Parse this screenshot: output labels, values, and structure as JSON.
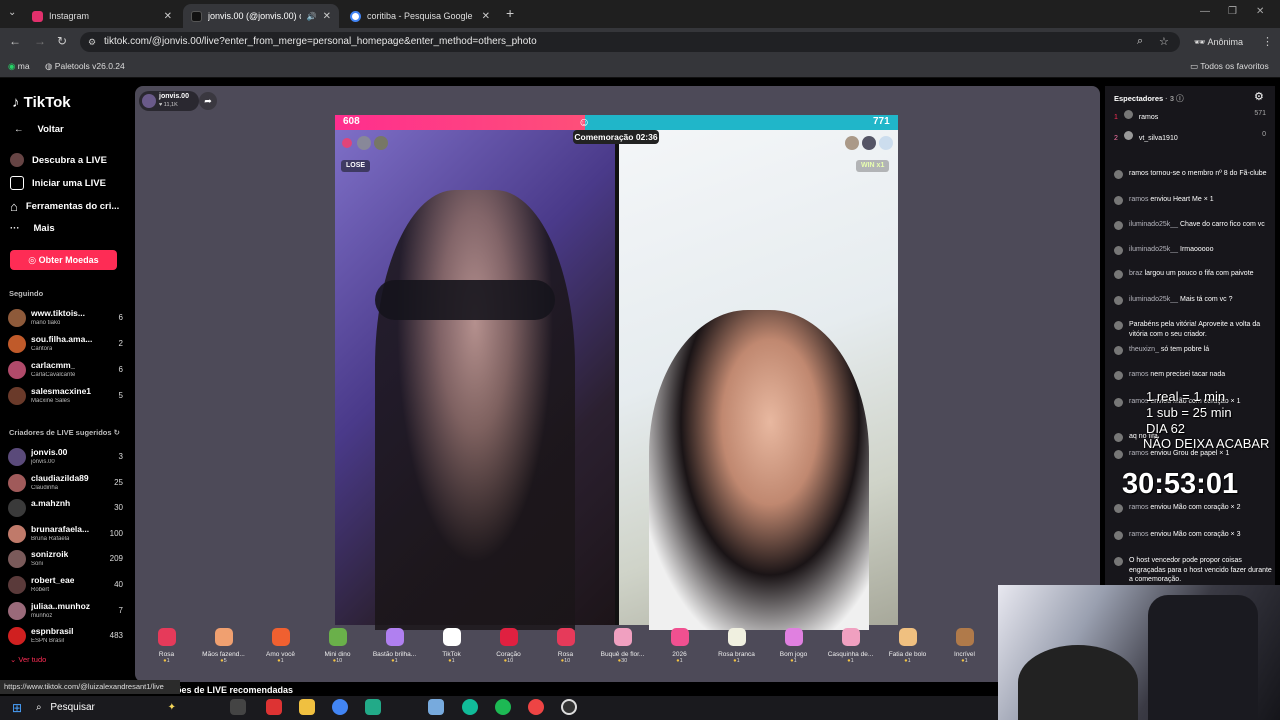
{
  "browser": {
    "tabs": [
      {
        "title": "Instagram",
        "color": "#e1306c"
      },
      {
        "title": "jonvis.00 (@jonvis.00) come",
        "color": "#111111"
      },
      {
        "title": "coritiba - Pesquisa Google",
        "color": "#4285f4"
      }
    ],
    "new_tab": "+",
    "url": "tiktok.com/@jonvis.00/live?enter_from_merge=personal_homepage&enter_method=others_photo",
    "profile": "Anônima",
    "bookmarks": [
      "ma",
      "Paletools v26.0.24"
    ],
    "favorites": "Todos os favoritos"
  },
  "sidebar": {
    "logo": "TikTok",
    "back": "Voltar",
    "nav": [
      "Descubra a LIVE",
      "Iniciar uma LIVE",
      "Ferramentas do cri...",
      "Mais"
    ],
    "coins_button": "Obter Moedas",
    "following_label": "Seguindo",
    "following": [
      {
        "name": "www.tiktois...",
        "sub": "mano tiako",
        "count": "6",
        "color": "#8e5a3a"
      },
      {
        "name": "sou.filha.ama...",
        "sub": "Cantora",
        "count": "2",
        "color": "#c05a2a"
      },
      {
        "name": "carlacmm_",
        "sub": "CarlaCavalcante",
        "count": "6",
        "color": "#b04a6a"
      },
      {
        "name": "salesmacxine1",
        "sub": "Macxine Sales",
        "count": "5",
        "color": "#6a3a2a"
      }
    ],
    "suggested_label": "Criadores de LIVE sugeridos",
    "suggested": [
      {
        "name": "jonvis.00",
        "sub": "jonvis.00",
        "count": "3",
        "color": "#5a4a7a"
      },
      {
        "name": "claudiazilda89",
        "sub": "Claudinha",
        "count": "25",
        "color": "#a05a5a"
      },
      {
        "name": "a.mahznh",
        "sub": "",
        "count": "30",
        "color": "#3a3a3a"
      },
      {
        "name": "brunarafaela...",
        "sub": "Bruna Rafaela",
        "count": "100",
        "color": "#c07a6a"
      },
      {
        "name": "sonizroik",
        "sub": "Soni",
        "count": "209",
        "color": "#7a5a5a"
      },
      {
        "name": "robert_eae",
        "sub": "Robert",
        "count": "40",
        "color": "#5a3a3a"
      },
      {
        "name": "juliaa..munhoz",
        "sub": "munhoz",
        "count": "7",
        "color": "#9a6a7a"
      },
      {
        "name": "espnbrasil",
        "sub": "ESPN Brasil",
        "count": "483",
        "color": "#d02020"
      }
    ],
    "see_all": "Ver tudo"
  },
  "live": {
    "host": "jonvis.00",
    "viewers_short": "11,1K",
    "score_left": "608",
    "score_right": "771",
    "timer": "Comemoração 02:36",
    "lose": "LOSE",
    "win": "WIN x1"
  },
  "gifts": [
    {
      "name": "Rosa",
      "price": "1",
      "color": "#e63a5a"
    },
    {
      "name": "Mãos fazend...",
      "price": "5",
      "color": "#f0a070"
    },
    {
      "name": "Amo você",
      "price": "1",
      "color": "#f06030"
    },
    {
      "name": "Mini dino",
      "price": "10",
      "color": "#6ab04a"
    },
    {
      "name": "Bastão brilha...",
      "price": "1",
      "color": "#b080f0"
    },
    {
      "name": "TikTok",
      "price": "1",
      "color": "#ffffff"
    },
    {
      "name": "Coração",
      "price": "10",
      "color": "#e02040"
    },
    {
      "name": "Rosa",
      "price": "10",
      "color": "#e63a5a"
    },
    {
      "name": "Buquê de flor...",
      "price": "30",
      "color": "#f0a0c0"
    },
    {
      "name": "2026",
      "price": "1",
      "color": "#f05090"
    },
    {
      "name": "Rosa branca",
      "price": "1",
      "color": "#f0f0e0"
    },
    {
      "name": "Bom jogo",
      "price": "1",
      "color": "#e080e0"
    },
    {
      "name": "Casquinha de...",
      "price": "1",
      "color": "#f0a0c0"
    },
    {
      "name": "Fatia de bolo",
      "price": "1",
      "color": "#f0c080"
    },
    {
      "name": "Incrível",
      "price": "1",
      "color": "#b07a4a"
    }
  ],
  "recommended_label": "ões de LIVE recomendadas",
  "chat": {
    "viewers_title": "Espectadores",
    "viewers_count": "· 3",
    "top_viewers": [
      {
        "rank": "1",
        "name": "ramos",
        "score": "571"
      },
      {
        "rank": "2",
        "name": "vt_silva1910",
        "score": "0"
      }
    ],
    "messages": [
      {
        "user": "",
        "text": "ramos tornou-se o membro nº 8 do Fã-clube"
      },
      {
        "user": "ramos",
        "text": "enviou Heart Me × 1"
      },
      {
        "user": "iluminado25k__",
        "text": "Chave do carro fico com vc"
      },
      {
        "user": "iluminado25k__",
        "text": "Irmaooooo"
      },
      {
        "user": "braz",
        "text": "largou um pouco o fifa com paivote"
      },
      {
        "user": "iluminado25k__",
        "text": "Mais tá com vc ?"
      },
      {
        "user": "",
        "text": "Parabéns pela vitória! Aproveite a volta da vitória com o seu criador."
      },
      {
        "user": "theuxizn_",
        "text": "só tem pobre lá"
      },
      {
        "user": "ramos",
        "text": "nem precisei tacar nada"
      },
      {
        "user": "ramos",
        "text": "enviou Mão com coração × 1"
      },
      {
        "user": "",
        "text": "aq no fifa"
      },
      {
        "user": "ramos",
        "text": "enviou Grou de papel × 1"
      },
      {
        "user": "ramos",
        "text": "enviou Mão com coração × 2"
      },
      {
        "user": "ramos",
        "text": "enviou Mão com coração × 3"
      },
      {
        "user": "",
        "text": "O host vencedor pode propor coisas engraçadas para o host vencido fazer durante a comemoração."
      }
    ]
  },
  "overlay": {
    "line1": "1 real = 1 min",
    "line2": "1 sub = 25 min",
    "line3": "DIA 62",
    "line4": "NÃO DEIXA ACABAR",
    "timer": "30:53:01"
  },
  "status_url": "https://www.tiktok.com/@luizalexandresant1/live",
  "taskbar": {
    "search": "Pesquisar"
  }
}
